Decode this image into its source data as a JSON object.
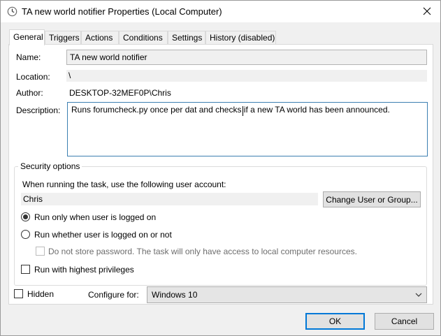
{
  "window": {
    "title": "TA new world notifier Properties (Local Computer)",
    "icon": "task-scheduler-icon",
    "close_icon": "close-icon"
  },
  "tabs": [
    {
      "label": "General",
      "active": true
    },
    {
      "label": "Triggers",
      "active": false
    },
    {
      "label": "Actions",
      "active": false
    },
    {
      "label": "Conditions",
      "active": false
    },
    {
      "label": "Settings",
      "active": false
    },
    {
      "label": "History (disabled)",
      "active": false
    }
  ],
  "general": {
    "name_label": "Name:",
    "name_value": "TA new world notifier",
    "location_label": "Location:",
    "location_value": "\\",
    "author_label": "Author:",
    "author_value": "DESKTOP-32MEF0P\\Chris",
    "description_label": "Description:",
    "description_value": "Runs forumcheck.py once per dat and checks if a new TA world has been announced."
  },
  "security": {
    "title": "Security options",
    "account_prompt": "When running the task, use the following user account:",
    "account_value": "Chris",
    "change_user_button": "Change User or Group...",
    "radio_logged_on": "Run only when user is logged on",
    "radio_logged_on_checked": true,
    "radio_whether": "Run whether user is logged on or not",
    "radio_whether_checked": false,
    "no_store_password": "Do not store password.  The task will only have access to local computer resources.",
    "no_store_password_enabled": false,
    "highest_privileges": "Run with highest privileges",
    "highest_privileges_checked": false
  },
  "footer_options": {
    "hidden_label": "Hidden",
    "hidden_checked": false,
    "configure_label": "Configure for:",
    "configure_value": "Windows 10"
  },
  "buttons": {
    "ok": "OK",
    "cancel": "Cancel"
  },
  "colors": {
    "accent": "#0078d7",
    "focus_border": "#3c7fb1",
    "dialog_bg": "#f0f0f0"
  }
}
